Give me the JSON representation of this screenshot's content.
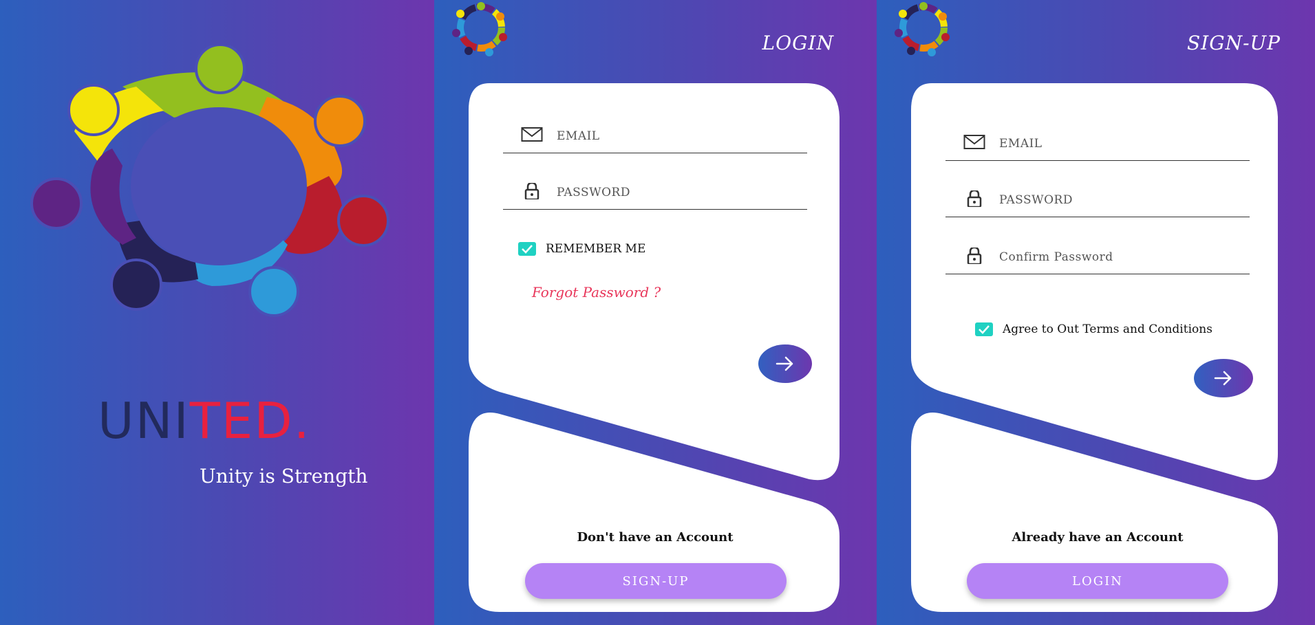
{
  "splash": {
    "brand_part1": "UNI",
    "brand_part2": "TED.",
    "tagline": "Unity is Strength"
  },
  "login": {
    "title": "LOGIN",
    "email_placeholder": "EMAIL",
    "password_placeholder": "PASSWORD",
    "remember_label": "REMEMBER ME",
    "remember_checked": true,
    "forgot_label": "Forgot Password ?",
    "prompt": "Don't have an Account",
    "alt_button": "SIGN-UP"
  },
  "signup": {
    "title": "SIGN-UP",
    "email_placeholder": "EMAIL",
    "password_placeholder": "PASSWORD",
    "confirm_placeholder": "Confirm Password",
    "terms_label": "Agree to Out Terms and Conditions",
    "terms_checked": true,
    "prompt": "Already have an Account",
    "alt_button": "LOGIN"
  },
  "icons": {
    "email": "mail-icon",
    "password": "lock-icon",
    "check": "checkmark-icon",
    "next": "arrow-right-icon",
    "logo": "people-circle-logo"
  },
  "colors": {
    "gradient_start": "#2d5fbd",
    "gradient_end": "#6d36ae",
    "accent_red": "#e8213f",
    "brand_dark": "#222a5c",
    "checkbox": "#1fd1c2",
    "pill_button": "#b583f5",
    "forgot_link": "#e8365a"
  }
}
